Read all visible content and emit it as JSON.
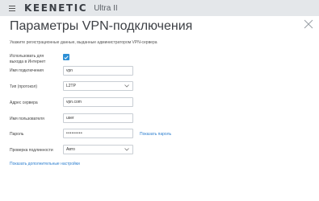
{
  "header": {
    "brand": "KEENETIC",
    "model": "Ultra II"
  },
  "dialog": {
    "title": "Параметры VPN-подключения",
    "subtitle": "Укажите регистрационные данные, выданные администратором VPN-сервера"
  },
  "form": {
    "internet_label": "Использовать для выхода в Интернет",
    "internet_checked": true,
    "name_label": "Имя подключения",
    "name_value": "vpn",
    "type_label": "Тип (протокол)",
    "type_value": "L2TP",
    "server_label": "Адрес сервера",
    "server_value": "vpn.com",
    "user_label": "Имя пользователя",
    "user_value": "user",
    "password_label": "Пароль",
    "password_value": "•••••••••",
    "show_password": "Показать пароль",
    "ping_label": "Проверка подлинности",
    "ping_value": "Авто",
    "more_settings": "Показать дополнительные настройки"
  },
  "colors": {
    "accent": "#2d8fd5",
    "link": "#2d7fcf",
    "topbar": "#e4e7ea"
  },
  "icons": {
    "menu": "hamburger-icon",
    "close": "close-icon",
    "check": "checkmark-icon",
    "dropdown": "chevron-down-icon"
  }
}
